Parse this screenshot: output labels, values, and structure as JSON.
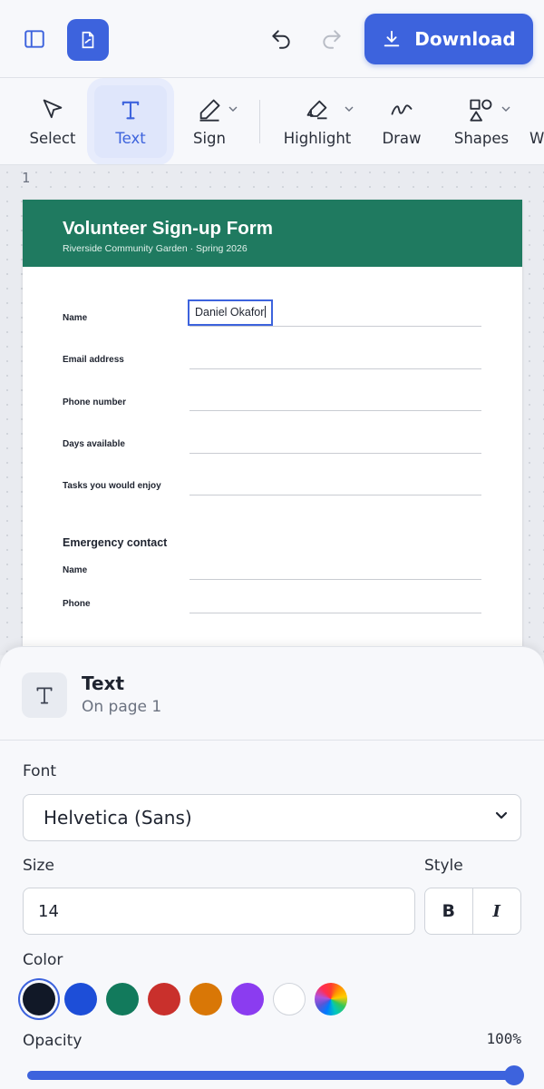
{
  "header": {
    "download_label": "Download",
    "icons": [
      "sidebar-icon",
      "document-icon",
      "undo-icon",
      "redo-icon",
      "download-icon"
    ],
    "accent_color": "#3d63dd"
  },
  "toolbar": {
    "tools": [
      {
        "label": "Select",
        "icon": "cursor-icon",
        "active": false
      },
      {
        "label": "Text",
        "icon": "text-icon",
        "active": true
      },
      {
        "label": "Sign",
        "icon": "pen-icon",
        "active": false
      },
      {
        "label": "Highlight",
        "icon": "highlighter-icon",
        "active": false
      },
      {
        "label": "Draw",
        "icon": "squiggle-icon",
        "active": false
      },
      {
        "label": "Shapes",
        "icon": "shapes-icon",
        "active": false
      },
      {
        "label": "W",
        "icon": "",
        "active": false
      }
    ]
  },
  "canvas": {
    "page_number": "1",
    "form": {
      "title": "Volunteer Sign-up Form",
      "subtitle": "Riverside Community Garden  ·  Spring 2026",
      "header_color": "#1f7a60",
      "fields": [
        {
          "label": "Name",
          "value": "Daniel Okafor"
        },
        {
          "label": "Email address",
          "value": ""
        },
        {
          "label": "Phone number",
          "value": ""
        },
        {
          "label": "Days available",
          "value": ""
        },
        {
          "label": "Tasks you would enjoy",
          "value": ""
        }
      ],
      "emergency": {
        "title": "Emergency contact",
        "fields": [
          {
            "label": "Name",
            "value": ""
          },
          {
            "label": "Phone",
            "value": ""
          }
        ]
      }
    }
  },
  "panel": {
    "title": "Text",
    "subtitle": "On page 1",
    "font_label": "Font",
    "font_value": "Helvetica (Sans)",
    "size_label": "Size",
    "size_value": "14",
    "style_label": "Style",
    "bold_label": "B",
    "italic_label": "I",
    "color_label": "Color",
    "colors": [
      "#111827",
      "#1d4ed8",
      "#127a5c",
      "#c9302c",
      "#d97706",
      "#8b3cf0",
      "#ffffff",
      "custom"
    ],
    "selected_color": "#111827",
    "opacity_label": "Opacity",
    "opacity_value": "100%",
    "opacity_fraction": 1.0
  }
}
